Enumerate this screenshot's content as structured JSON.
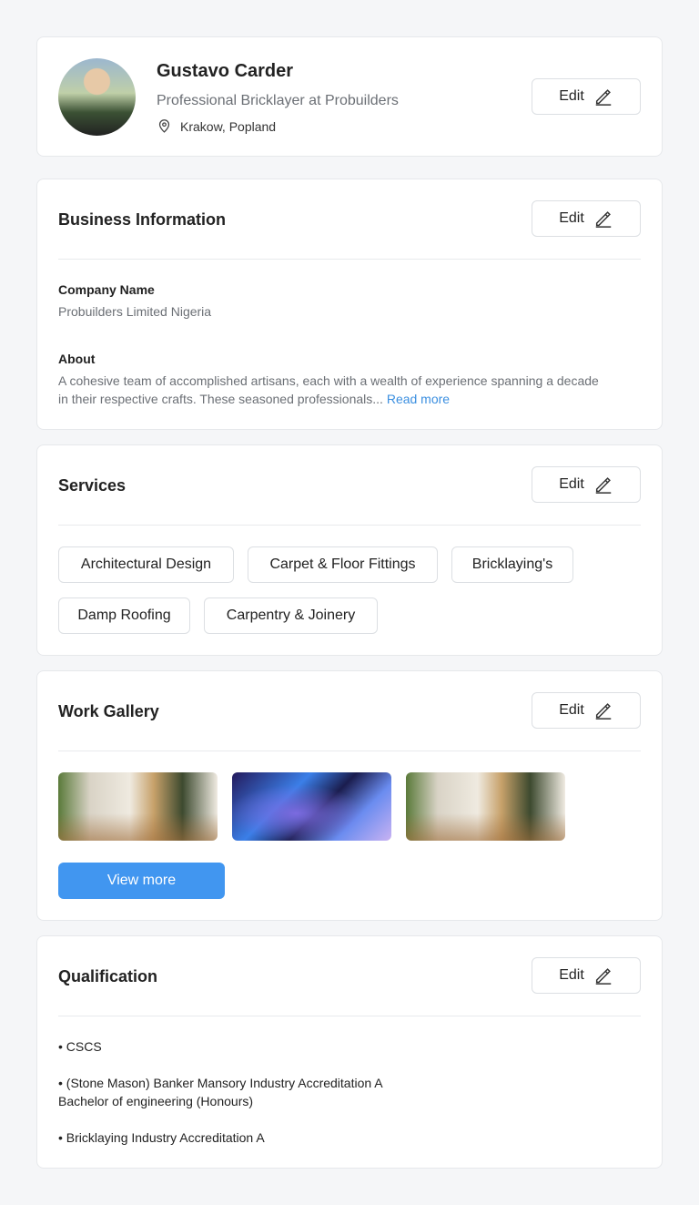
{
  "profile": {
    "name": "Gustavo Carder",
    "title": "Professional Bricklayer at Probuilders",
    "location": "Krakow, Popland",
    "edit_label": "Edit"
  },
  "business": {
    "heading": "Business Information",
    "edit_label": "Edit",
    "company_label": "Company Name",
    "company_value": "Probuilders Limited Nigeria",
    "about_label": "About",
    "about_line1": "A cohesive team of accomplished artisans, each with a wealth of experience spanning a decade",
    "about_line2": "in their respective crafts. These seasoned professionals...",
    "read_more": "Read more"
  },
  "services": {
    "heading": "Services",
    "edit_label": "Edit",
    "items": [
      "Architectural Design",
      "Carpet & Floor Fittings",
      "Bricklaying's",
      "Damp Roofing",
      "Carpentry & Joinery"
    ]
  },
  "gallery": {
    "heading": "Work Gallery",
    "edit_label": "Edit",
    "view_more": "View more"
  },
  "qualification": {
    "heading": "Qualification",
    "edit_label": "Edit",
    "items": [
      "• CSCS",
      "• (Stone Mason) Banker Mansory Industry Accreditation A",
      "Bachelor of engineering (Honours)",
      "• Bricklaying Industry Accreditation A"
    ]
  },
  "colors": {
    "accent": "#4196f0",
    "link": "#3b8fe0",
    "background": "#f5f6f8"
  }
}
